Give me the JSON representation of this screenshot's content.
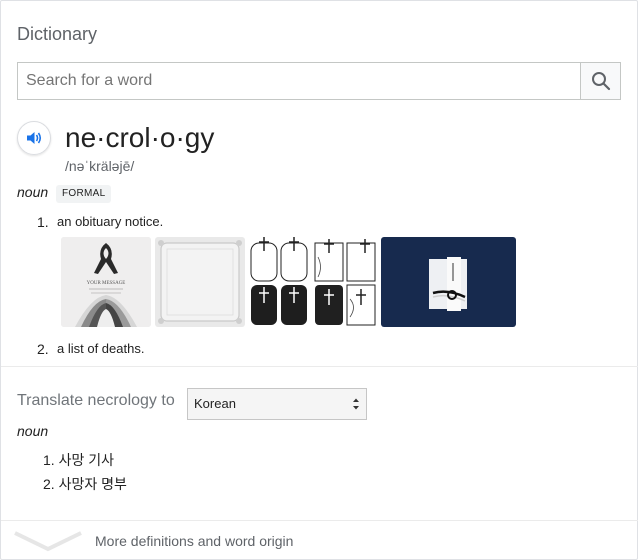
{
  "header": {
    "title": "Dictionary"
  },
  "search": {
    "placeholder": "Search for a word"
  },
  "entry": {
    "word": "ne·crol·o·gy",
    "pronunciation": "/nəˈkräləjē/",
    "part_of_speech": "noun",
    "register_badge": "FORMAL",
    "definitions": [
      {
        "number": "1.",
        "text": "an obituary notice."
      },
      {
        "number": "2.",
        "text": "a list of deaths."
      }
    ],
    "images": [
      {
        "name": "black-ribbon-obituary-image",
        "caption": "YOUR MESSAGE"
      },
      {
        "name": "gray-frame-image"
      },
      {
        "name": "cross-frames-image-1"
      },
      {
        "name": "cross-frames-image-2"
      },
      {
        "name": "funeral-envelope-image"
      }
    ]
  },
  "translate": {
    "label": "Translate necrology to",
    "language": "Korean",
    "part_of_speech": "noun",
    "items": [
      {
        "number": "1.",
        "text": "사망 기사"
      },
      {
        "number": "2.",
        "text": "사망자 명부"
      }
    ]
  },
  "footer": {
    "more_label": "More definitions and word origin"
  },
  "colors": {
    "accent": "#1a73e8",
    "muted": "#5f6368",
    "border": "#dfe1e5"
  },
  "icons": [
    "search-icon",
    "speaker-icon",
    "chevron-down-icon",
    "select-arrows-icon"
  ]
}
